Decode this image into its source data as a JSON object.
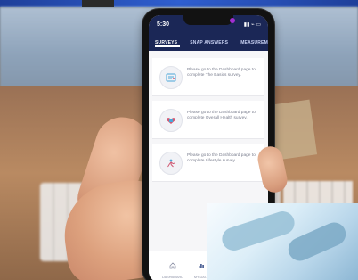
{
  "status_bar": {
    "time": "5:30",
    "indicators": "▮▮ ⌁ ▭"
  },
  "tabs": [
    {
      "label": "SURVEYS"
    },
    {
      "label": "SNAP ANSWERS"
    },
    {
      "label": "MEASUREMENT"
    }
  ],
  "survey_cards": [
    {
      "icon": "basics-icon",
      "text": "Please go to the Dashboard page to complete The Basics survey."
    },
    {
      "icon": "heart-health-icon",
      "text": "Please go to the Dashboard page to complete Overall Health survey."
    },
    {
      "icon": "lifestyle-icon",
      "text": "Please go to the Dashboard page to complete Lifestyle survey."
    }
  ],
  "bottom_nav": [
    {
      "label": "DASHBOARD",
      "icon": "home-icon"
    },
    {
      "label": "MY DATA",
      "icon": "bar-chart-icon"
    }
  ],
  "colors": {
    "header": "#1b2756",
    "background": "#f6f6f8",
    "accent": "#a12fd2"
  }
}
